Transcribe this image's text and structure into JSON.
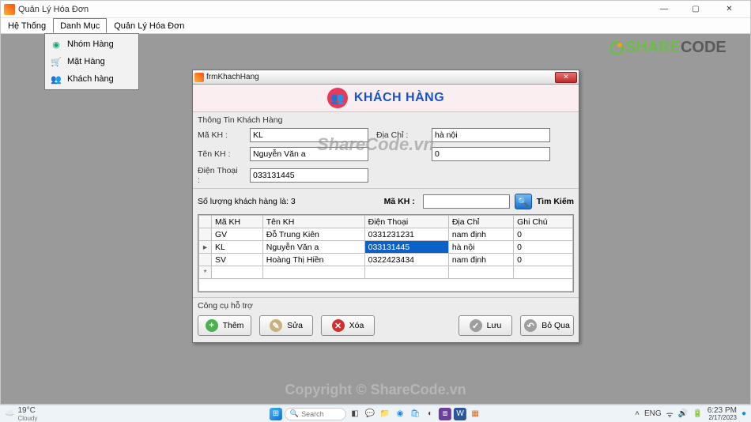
{
  "outer": {
    "title": "Quản Lý Hóa Đơn"
  },
  "menu": {
    "items": [
      "Hệ Thống",
      "Danh Mục",
      "Quản Lý Hóa Đơn"
    ],
    "active_index": 1,
    "dropdown": [
      {
        "icon": "circle",
        "label": "Nhóm Hàng"
      },
      {
        "icon": "cart",
        "label": "Mặt Hàng"
      },
      {
        "icon": "people",
        "label": "Khách hàng"
      }
    ]
  },
  "watermark": {
    "brand1": "SHARE",
    "brand2": "CODE",
    "suffix": ".vn",
    "center": "ShareCode.vn",
    "bottom": "Copyright © ShareCode.vn"
  },
  "child": {
    "title": "frmKhachHang",
    "banner": "KHÁCH HÀNG",
    "section_info": "Thông Tin Khách Hàng",
    "labels": {
      "ma": "Mã KH :",
      "ten": "Tên KH :",
      "dt": "Điện Thoại :",
      "dc": "Địa Chỉ :",
      "gc_blank": ""
    },
    "values": {
      "ma": "KL",
      "ten": "Nguyễn Văn a",
      "dt": "033131445",
      "dc": "hà nội",
      "gc": "0"
    },
    "count_text": "Số lượng khách hàng là:  3",
    "search_label": "Mã KH :",
    "search_value": "",
    "search_btn": "Tìm Kiếm",
    "columns": [
      "Mã KH",
      "Tên KH",
      "Điện Thoại",
      "Địa Chỉ",
      "Ghi Chú"
    ],
    "rows": [
      {
        "ma": "GV",
        "ten": "Đỗ Trung Kiên",
        "dt": "0331231231",
        "dc": "nam định",
        "gc": "0"
      },
      {
        "ma": "KL",
        "ten": "Nguyễn Văn a",
        "dt": "033131445",
        "dc": "hà nội",
        "gc": "0"
      },
      {
        "ma": "SV",
        "ten": "Hoàng Thị Hiền",
        "dt": "0322423434",
        "dc": "nam định",
        "gc": "0"
      }
    ],
    "selected_row": 1,
    "tools_title": "Công cụ hỗ trợ",
    "buttons": {
      "add": "Thêm",
      "edit": "Sửa",
      "del": "Xóa",
      "save": "Lưu",
      "skip": "Bỏ Qua"
    }
  },
  "taskbar": {
    "temp": "19°C",
    "cond": "Cloudy",
    "search_placeholder": "Search",
    "lang": "ENG",
    "time": "6:23 PM",
    "date": "2/17/2023"
  }
}
